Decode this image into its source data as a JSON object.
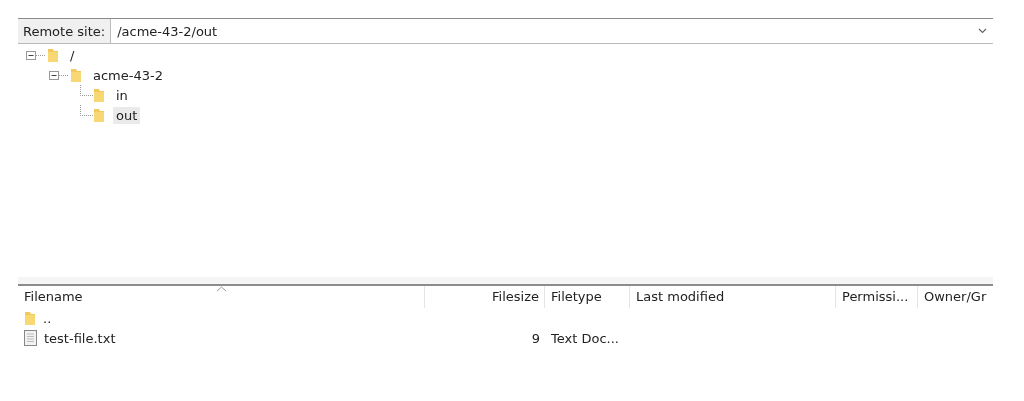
{
  "remote_site": {
    "label": "Remote site:",
    "value": "/acme-43-2/out"
  },
  "tree": [
    {
      "name": "/",
      "expanded": true,
      "selected": false,
      "children": [
        {
          "name": "acme-43-2",
          "expanded": true,
          "selected": false,
          "children": [
            {
              "name": "in",
              "selected": false
            },
            {
              "name": "out",
              "selected": true
            }
          ]
        }
      ]
    }
  ],
  "file_list": {
    "columns": [
      {
        "label": "Filename",
        "sorted": true
      },
      {
        "label": "Filesize",
        "sorted": false
      },
      {
        "label": "Filetype",
        "sorted": false
      },
      {
        "label": "Last modified",
        "sorted": false
      },
      {
        "label": "Permissi...",
        "sorted": false
      },
      {
        "label": "Owner/Gr",
        "sorted": false
      }
    ],
    "rows": [
      {
        "kind": "folder",
        "name": ".."
      },
      {
        "kind": "file",
        "name": "test-file.txt",
        "size": "9",
        "type": "Text Doc..."
      }
    ]
  }
}
